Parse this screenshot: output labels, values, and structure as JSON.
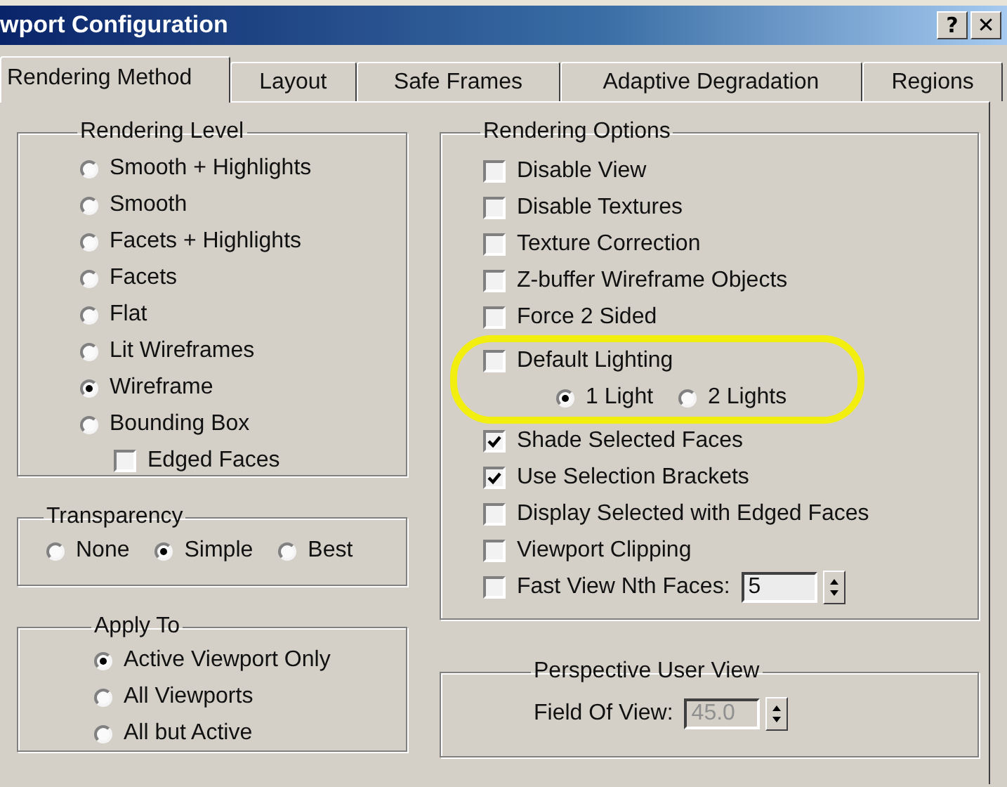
{
  "window": {
    "title": "wport Configuration",
    "buttons": [
      "?",
      "✕"
    ]
  },
  "tabs": [
    {
      "label": "Rendering Method",
      "selected": true
    },
    {
      "label": "Layout",
      "selected": false
    },
    {
      "label": "Safe Frames",
      "selected": false
    },
    {
      "label": "Adaptive Degradation",
      "selected": false
    },
    {
      "label": "Regions",
      "selected": false
    }
  ],
  "rendering_level": {
    "title": "Rendering Level",
    "options": [
      {
        "label": "Smooth + Highlights",
        "selected": false
      },
      {
        "label": "Smooth",
        "selected": false
      },
      {
        "label": "Facets + Highlights",
        "selected": false
      },
      {
        "label": "Facets",
        "selected": false
      },
      {
        "label": "Flat",
        "selected": false
      },
      {
        "label": "Lit Wireframes",
        "selected": false
      },
      {
        "label": "Wireframe",
        "selected": true
      },
      {
        "label": "Bounding Box",
        "selected": false
      }
    ],
    "edged_faces": {
      "label": "Edged Faces",
      "checked": false
    }
  },
  "transparency": {
    "title": "Transparency",
    "options": [
      {
        "label": "None",
        "selected": false
      },
      {
        "label": "Simple",
        "selected": true
      },
      {
        "label": "Best",
        "selected": false
      }
    ]
  },
  "apply_to": {
    "title": "Apply To",
    "options": [
      {
        "label": "Active Viewport Only",
        "selected": true
      },
      {
        "label": "All Viewports",
        "selected": false
      },
      {
        "label": "All but Active",
        "selected": false
      }
    ]
  },
  "rendering_options": {
    "title": "Rendering Options",
    "items": [
      {
        "kind": "checkbox",
        "label": "Disable View",
        "checked": false
      },
      {
        "kind": "checkbox",
        "label": "Disable Textures",
        "checked": false
      },
      {
        "kind": "checkbox",
        "label": "Texture Correction",
        "checked": false
      },
      {
        "kind": "checkbox",
        "label": "Z-buffer Wireframe Objects",
        "checked": false
      },
      {
        "kind": "checkbox",
        "label": "Force 2 Sided",
        "checked": false
      },
      {
        "kind": "checkbox",
        "label": "Default Lighting",
        "checked": false
      },
      {
        "kind": "radios",
        "options": [
          {
            "label": "1 Light",
            "selected": true
          },
          {
            "label": "2 Lights",
            "selected": false
          }
        ]
      },
      {
        "kind": "checkbox",
        "label": "Shade Selected Faces",
        "checked": true
      },
      {
        "kind": "checkbox",
        "label": "Use Selection Brackets",
        "checked": true
      },
      {
        "kind": "checkbox",
        "label": "Display Selected with Edged Faces",
        "checked": false
      },
      {
        "kind": "checkbox",
        "label": "Viewport Clipping",
        "checked": false
      },
      {
        "kind": "spinner",
        "label": "Fast View Nth Faces:",
        "checked": false,
        "value": "5",
        "disabled": false
      }
    ]
  },
  "perspective": {
    "title": "Perspective User View",
    "field": {
      "label": "Field Of View:",
      "value": "45.0",
      "disabled": true
    }
  },
  "annotation": {
    "kind": "ellipse"
  }
}
